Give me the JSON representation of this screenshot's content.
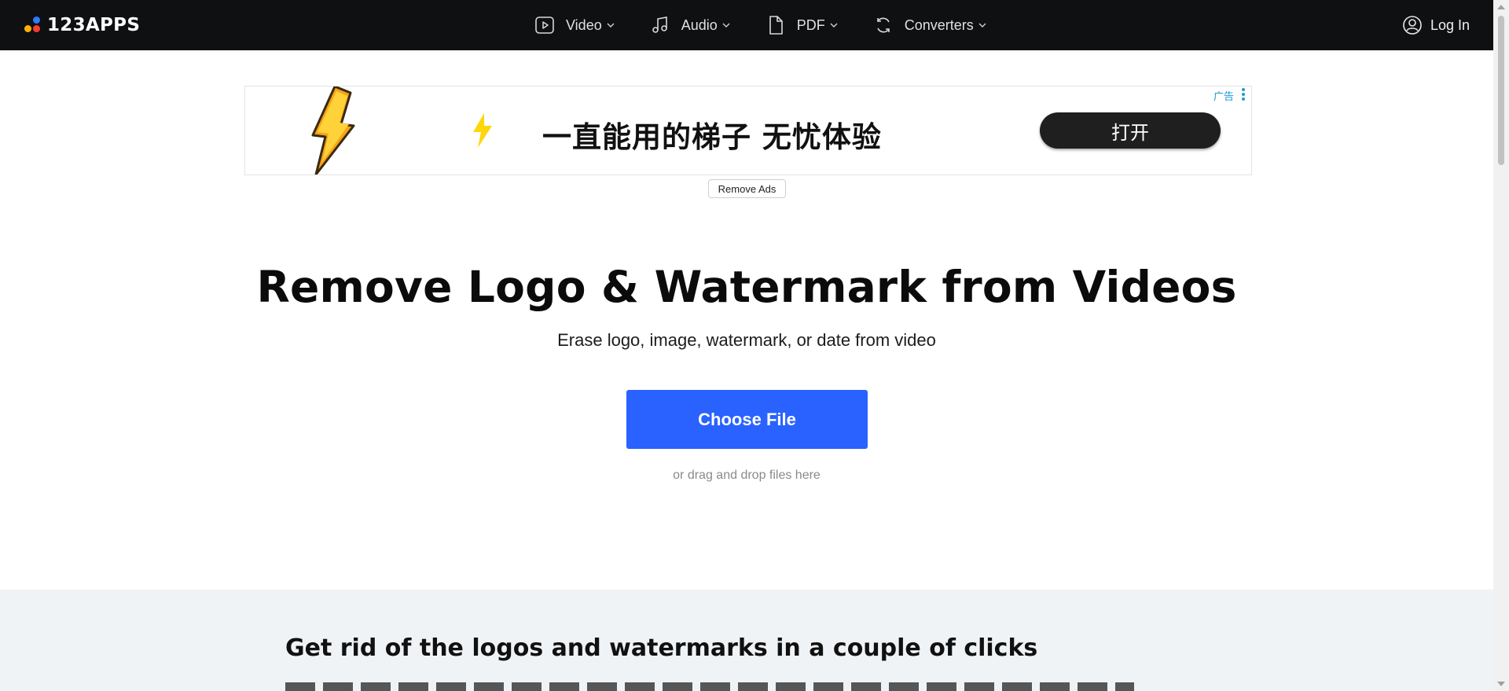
{
  "nav": {
    "brand": "123APPS",
    "items": [
      {
        "label": "Video",
        "icon": "video-icon"
      },
      {
        "label": "Audio",
        "icon": "music-note-icon"
      },
      {
        "label": "PDF",
        "icon": "document-icon"
      },
      {
        "label": "Converters",
        "icon": "convert-icon"
      }
    ],
    "login_label": "Log In"
  },
  "ad": {
    "text": "一直能用的梯子 无忧体验",
    "button_label": "打开",
    "ad_label": "广告",
    "remove_ads_label": "Remove Ads"
  },
  "hero": {
    "title": "Remove Logo & Watermark from Videos",
    "subtitle": "Erase logo, image, watermark, or date from video",
    "choose_file_label": "Choose File",
    "drag_text": "or drag and drop files here"
  },
  "section": {
    "title": "Get rid of the logos and watermarks in a couple of clicks"
  },
  "colors": {
    "topbar": "#0f1011",
    "primary_button": "#2962ff",
    "section_bg": "#f0f3f6",
    "ad_label": "#1a9bd7"
  }
}
